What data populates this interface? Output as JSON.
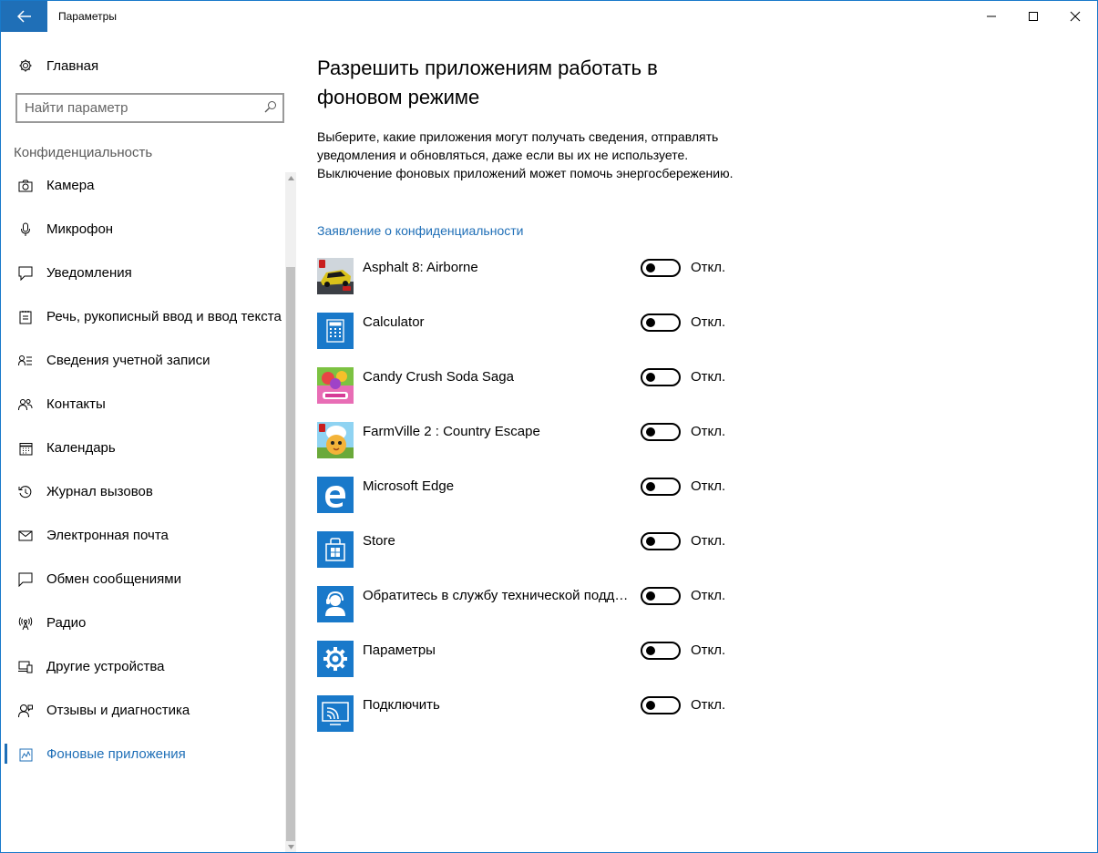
{
  "window": {
    "title": "Параметры"
  },
  "sidebar": {
    "home_label": "Главная",
    "search_placeholder": "Найти параметр",
    "section_label": "Конфиденциальность",
    "items": [
      {
        "label": "Камера",
        "icon": "camera-icon"
      },
      {
        "label": "Микрофон",
        "icon": "microphone-icon"
      },
      {
        "label": "Уведомления",
        "icon": "notification-icon"
      },
      {
        "label": "Речь, рукописный ввод и ввод текста",
        "icon": "speech-icon"
      },
      {
        "label": "Сведения учетной записи",
        "icon": "account-info-icon"
      },
      {
        "label": "Контакты",
        "icon": "contacts-icon"
      },
      {
        "label": "Календарь",
        "icon": "calendar-icon"
      },
      {
        "label": "Журнал вызовов",
        "icon": "call-history-icon"
      },
      {
        "label": "Электронная почта",
        "icon": "email-icon"
      },
      {
        "label": "Обмен сообщениями",
        "icon": "messaging-icon"
      },
      {
        "label": "Радио",
        "icon": "radio-icon"
      },
      {
        "label": "Другие устройства",
        "icon": "devices-icon"
      },
      {
        "label": "Отзывы и диагностика",
        "icon": "feedback-icon"
      },
      {
        "label": "Фоновые приложения",
        "icon": "background-apps-icon",
        "active": true
      }
    ]
  },
  "main": {
    "title": "Разрешить приложениям работать в фоновом режиме",
    "description": "Выберите, какие приложения могут получать сведения, отправлять уведомления и обновляться, даже если вы их не используете. Выключение фоновых приложений может помочь энергосбережению.",
    "privacy_link": "Заявление о конфиденциальности",
    "apps": [
      {
        "name": "Asphalt 8: Airborne",
        "state": "Откл.",
        "on": false,
        "icon": "asphalt-icon"
      },
      {
        "name": "Calculator",
        "state": "Откл.",
        "on": false,
        "icon": "calculator-icon"
      },
      {
        "name": "Candy Crush Soda Saga",
        "state": "Откл.",
        "on": false,
        "icon": "candy-crush-icon"
      },
      {
        "name": "FarmVille 2 : Country Escape",
        "state": "Откл.",
        "on": false,
        "icon": "farmville-icon"
      },
      {
        "name": "Microsoft Edge",
        "state": "Откл.",
        "on": false,
        "icon": "edge-icon"
      },
      {
        "name": "Store",
        "state": "Откл.",
        "on": false,
        "icon": "store-icon"
      },
      {
        "name": "Обратитесь в службу технической подде...",
        "state": "Откл.",
        "on": false,
        "icon": "support-icon"
      },
      {
        "name": "Параметры",
        "state": "Откл.",
        "on": false,
        "icon": "settings-icon"
      },
      {
        "name": "Подключить",
        "state": "Откл.",
        "on": false,
        "icon": "connect-icon"
      }
    ]
  },
  "colors": {
    "accent": "#1f6fb7",
    "app_tile": "#1979ca"
  }
}
